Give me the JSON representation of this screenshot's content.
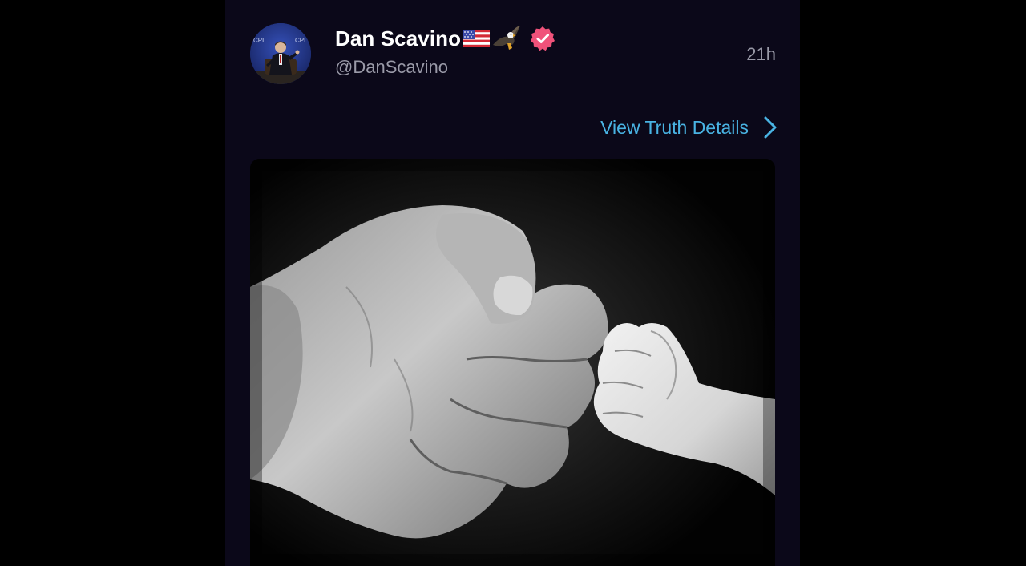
{
  "post": {
    "author": {
      "display_name": "Dan Scavino",
      "name_emoji": [
        "us-flag-icon",
        "eagle-icon"
      ],
      "handle": "@DanScavino",
      "verified": true
    },
    "timestamp": "21h",
    "details_link": "View Truth Details",
    "media": {
      "description": "black-and-white photo",
      "icon": "fist-bump-photo"
    }
  },
  "colors": {
    "panel_bg": "#0b0819",
    "link": "#49b3e3",
    "verified_badge": "#f0527a",
    "muted_text": "#9a9aa8"
  }
}
